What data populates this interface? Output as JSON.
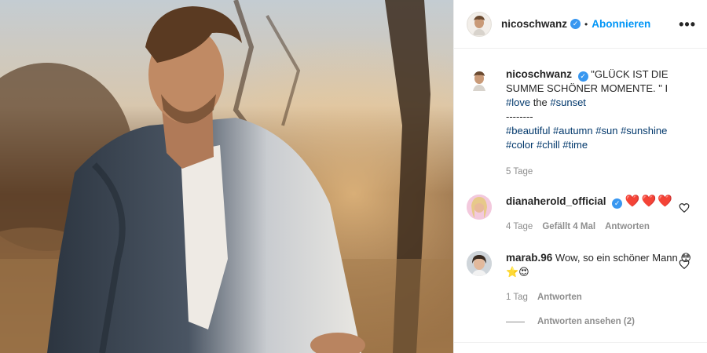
{
  "post": {
    "photo_alt": "man in denim jacket at sunset",
    "header": {
      "username": "nicoschwanz",
      "verified_icon": "verified-badge-icon",
      "separator": "•",
      "follow_label": "Abonnieren",
      "more_label": "•••"
    },
    "caption": {
      "username": "nicoschwanz",
      "text_1": "\"GLÜCK IST DIE SUMME SCHÖNER MOMENTE. \" I",
      "tag_love": "#love",
      "text_the": " the ",
      "tag_sunset": "#sunset",
      "divider": "--------",
      "tags_line_1": [
        "#beautiful",
        "#autumn",
        "#sun",
        "#sunshine"
      ],
      "tags_line_2": [
        "#color",
        "#chill",
        "#time"
      ],
      "age": "5 Tage"
    },
    "comments": [
      {
        "username": "dianaherold_official",
        "text": "❤️❤️❤️",
        "age": "4 Tage",
        "likes": "Gefällt 4 Mal",
        "reply_label": "Antworten"
      },
      {
        "username": "marab.96",
        "text": "Wow, so ein schöner Mann",
        "emojis": "😳⭐😍",
        "age": "1 Tag",
        "reply_label": "Antworten",
        "view_replies": "Antworten ansehen (2)"
      }
    ]
  },
  "colors": {
    "link": "#0095f6",
    "hashtag": "#00376b",
    "muted": "#8e8e8e",
    "verified": "#3897f0",
    "heart": "#ed4956"
  }
}
